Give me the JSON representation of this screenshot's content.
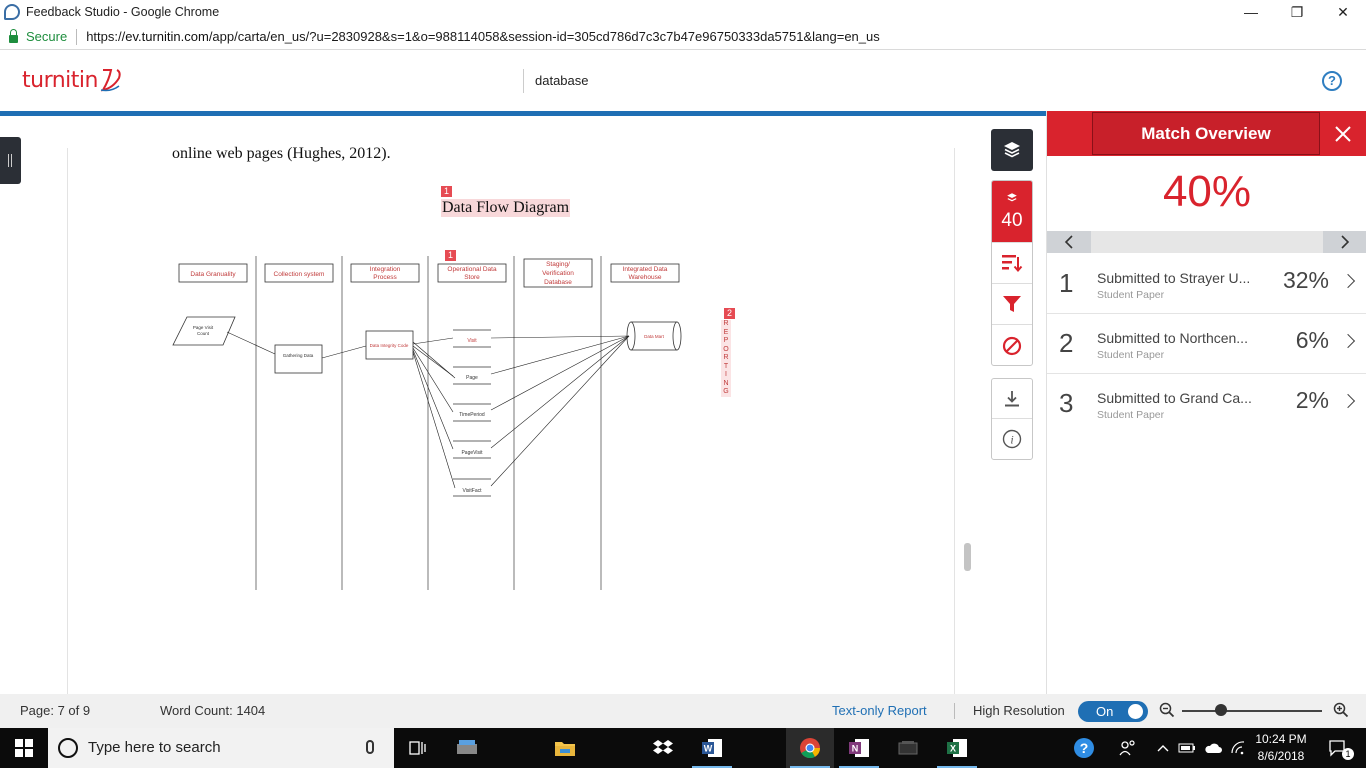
{
  "browser": {
    "window_title": "Feedback Studio - Google Chrome",
    "secure_label": "Secure",
    "url_prefix": "https://",
    "url_host": "ev.turnitin.com",
    "url_path": "/app/carta/en_us/?u=2830928&s=1&o=988114058&session-id=305cd786d7c3c7b47e96750333da5751&lang=en_us",
    "min_glyph": "—",
    "max_glyph": "❐",
    "close_glyph": "✕"
  },
  "header": {
    "logo_text": "turnitin",
    "document_title": "database",
    "help_glyph": "?"
  },
  "document": {
    "body_line": "online web pages (Hughes, 2012).",
    "diagram_title": "Data Flow Diagram",
    "match_marker_1": "1",
    "match_marker_2": "1",
    "match_marker_3": "2",
    "reporting_letters": [
      "R",
      "E",
      "P",
      "O",
      "R",
      "T",
      "I",
      "N",
      "G"
    ],
    "diagram": {
      "lane_headers": [
        "Data Granuality",
        "Collection system",
        "Integration Process",
        "Operational Data Store",
        "Staging/ Verification Database",
        "Integrated Data Warehouse"
      ],
      "source_node": "Page Visit Count",
      "collect_node": "Gathering Data",
      "integration_node": "Data Integrity Code",
      "store_nodes": [
        "Visit",
        "Page",
        "TimePeriod",
        "PageVisit",
        "VisitFact"
      ],
      "warehouse_node": "Data Mart"
    }
  },
  "tools": {
    "match_count": "40"
  },
  "panel": {
    "title": "Match Overview",
    "overall_score": "40%",
    "matches": [
      {
        "index": "1",
        "source": "Submitted to Strayer U...",
        "type": "Student Paper",
        "percent": "32%"
      },
      {
        "index": "2",
        "source": "Submitted to Northcen...",
        "type": "Student Paper",
        "percent": "6%"
      },
      {
        "index": "3",
        "source": "Submitted to Grand Ca...",
        "type": "Student Paper",
        "percent": "2%"
      }
    ]
  },
  "status": {
    "page_info": "Page: 7 of 9",
    "word_count": "Word Count: 1404",
    "text_only_report": "Text-only Report",
    "high_resolution": "High Resolution",
    "toggle_state": "On",
    "zoom_level": 0.28
  },
  "taskbar": {
    "search_placeholder": "Type here to search",
    "time": "10:24 PM",
    "date": "8/6/2018",
    "notification_count": "1"
  },
  "colors": {
    "turnitin_red": "#d9232d",
    "turnitin_blue": "#1f6fb4",
    "highlight_pink": "#f8d8da",
    "match_marker": "#e64b53"
  }
}
